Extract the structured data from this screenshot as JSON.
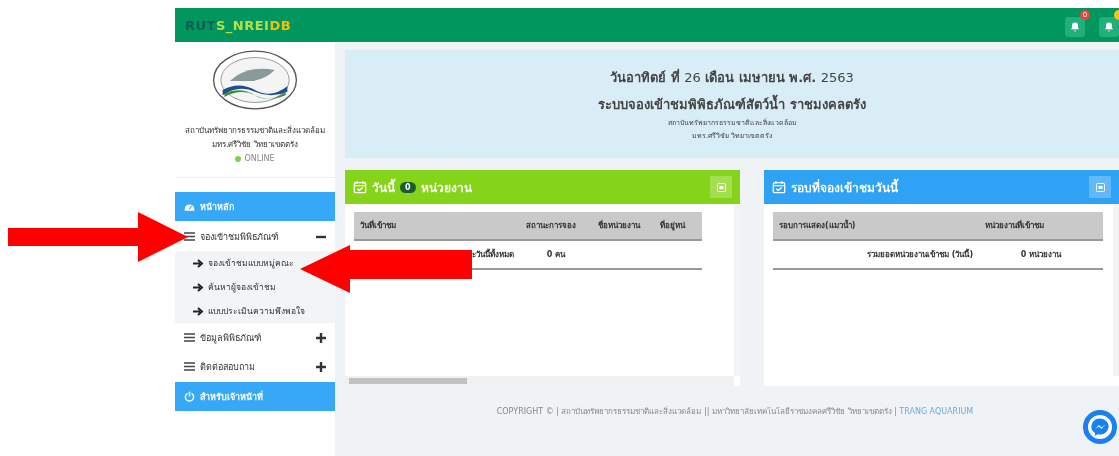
{
  "brand": {
    "parts": [
      {
        "text": "RUT",
        "color": "#0b5e55"
      },
      {
        "text": "S_NREI",
        "color": "#b5e04a"
      },
      {
        "text": "DB",
        "color": "#f2c200"
      }
    ]
  },
  "notifications": [
    {
      "badge": "0",
      "color": "#e8433a"
    },
    {
      "color": "#f5c518"
    }
  ],
  "sidebar": {
    "org_line_1": "สถาบันทรัพยากรธรรมชาติและสิ่งแวดล้อม",
    "org_line_2": "มทร.ศรีวิชัย วิทยาเขตตรัง",
    "status": "ONLINE",
    "online": true,
    "items": [
      {
        "kind": "main",
        "label": "หน้าหลัก"
      },
      {
        "kind": "group",
        "label": "จองเข้าชมพิพิธภัณฑ์",
        "expanded": true,
        "children": [
          {
            "label": "จองเข้าชมแบบหมู่คณะ"
          },
          {
            "label": "ค้นหาผู้จองเข้าชม"
          },
          {
            "label": "แบบประเมินความพึงพอใจ"
          }
        ]
      },
      {
        "kind": "group",
        "label": "ข้อมูลพิพิธภัณฑ์",
        "expanded": false
      },
      {
        "kind": "group",
        "label": "ติดต่อสอบถาม",
        "expanded": false
      },
      {
        "kind": "main",
        "label": "สำหรับเจ้าหน้าที่"
      }
    ]
  },
  "banner": {
    "date_prefix": "วันอาทิตย์ ที่",
    "day": "26",
    "month_part": "เดือน เมษายน พ.ศ.",
    "year": "2563",
    "title": "ระบบจองเข้าชมพิพิธภัณฑ์สัตว์น้ำ ราชมงคลตรัง",
    "line_1": "สถาบันทรัพยากรธรรมชาติและสิ่งแวดล้อม",
    "line_2": "มทร.ศรีวิชัย วิทยาเขตตรัง"
  },
  "panels": [
    {
      "color": "#86d419",
      "title_before": "วันนี้",
      "count": "0",
      "title_after": "หน่วยงาน",
      "columns": [
        "วันที่เข้าชม",
        "สถานะการจอง",
        "ชื่อหน่วยงาน",
        "ที่อยู่หน่"
      ],
      "rows": [
        [
          "ะวันนี้ทั้งหมด",
          "0 คน",
          "",
          ""
        ]
      ]
    },
    {
      "color": "#2fa2f5",
      "title_before": "รอบที่จองเข้าชมวันนี้",
      "columns": [
        "รอบการแสดง(แมวน้ำ)",
        "หน่วยงานที่เข้าชม"
      ],
      "rows": [
        [
          "รวมยอดหน่วยงานเข้าชม (วันนี้)",
          "0 หน่วยงาน"
        ]
      ]
    }
  ],
  "footer": {
    "text": "COPYRIGHT © | สถาบันทรัพยากรธรรมชาติและสิ่งแวดล้อม || มหาวิทยาลัยเทคโนโลยีราชมงคลศรีวิชัย วิทยาเขตตรัง |",
    "link": "TRANG AQUARIUM"
  }
}
